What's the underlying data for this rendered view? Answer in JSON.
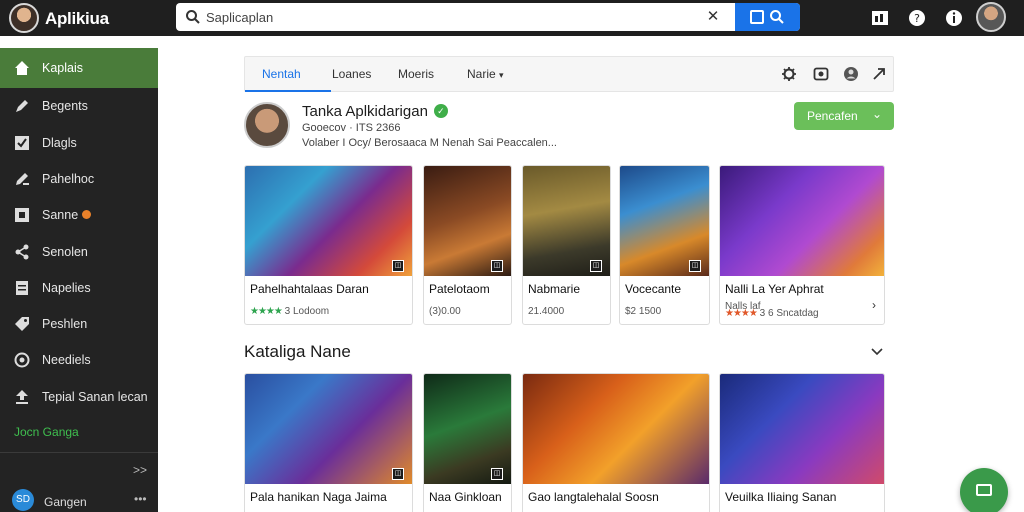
{
  "app": {
    "title": "Aplikiua"
  },
  "search": {
    "value": "Saplicaplan",
    "placeholder": ""
  },
  "sidebar": {
    "items": [
      {
        "label": "Kaplais",
        "icon": "home-icon"
      },
      {
        "label": "Begents",
        "icon": "pen-icon"
      },
      {
        "label": "Dlagls",
        "icon": "check-box-icon"
      },
      {
        "label": "Pahelhoc",
        "icon": "edit-icon"
      },
      {
        "label": "Sanne",
        "icon": "grid-icon"
      },
      {
        "label": "Senolen",
        "icon": "share-icon"
      },
      {
        "label": "Napelies",
        "icon": "document-icon"
      },
      {
        "label": "Peshlen",
        "icon": "tag-icon"
      },
      {
        "label": "Neediels",
        "icon": "clock-icon"
      },
      {
        "label": "Tepial Sanan lecan",
        "icon": "upload-icon"
      }
    ],
    "green_link": "Jocn Ganga",
    "footer_label": "Gangen",
    "footer_icon_text": "SD"
  },
  "tabs": [
    {
      "label": "Nentah"
    },
    {
      "label": "Loanes"
    },
    {
      "label": "Moeris"
    },
    {
      "label": "Narie"
    }
  ],
  "profile": {
    "name": "Tanka Aplkidarigan",
    "meta": "Gooecov · ITS 2366",
    "desc": "Volaber I Ocy/ Berosaaca M Nenah Sai Peaccalen..."
  },
  "follow_button": {
    "label": "Pencafen"
  },
  "top_cards": [
    {
      "title": "Pahelhahtalaas Daran",
      "meta": "3 Lodoom",
      "stars": "★★★★",
      "star_style": "green"
    },
    {
      "title": "Patelotaom",
      "meta": "(3)0.00",
      "stars": "",
      "star_style": ""
    },
    {
      "title": "Nabmarie",
      "meta": "21.4000",
      "stars": "",
      "star_style": ""
    },
    {
      "title": "Vocecante",
      "meta": "$2 1500",
      "stars": "",
      "star_style": ""
    },
    {
      "title": "Nalli La Yer Aphrat",
      "meta": "3 6 Sncatdag",
      "stars": "★★★★",
      "star_style": "red",
      "tag": "Nalls laf"
    }
  ],
  "section": {
    "title": "Kataliga Nane"
  },
  "bottom_cards": [
    {
      "title": "Pala hanikan Naga Jaima"
    },
    {
      "title": "Naa Ginkloan"
    },
    {
      "title": "Gao langtalehalal Soosn"
    },
    {
      "title": "Veuilka Iliaing Sanan"
    }
  ],
  "colors": {
    "accent_blue": "#1a73e8",
    "sidebar_active": "#4a7c3a",
    "follow_green": "#6bbf5a",
    "fab_green": "#3a9a4a"
  }
}
